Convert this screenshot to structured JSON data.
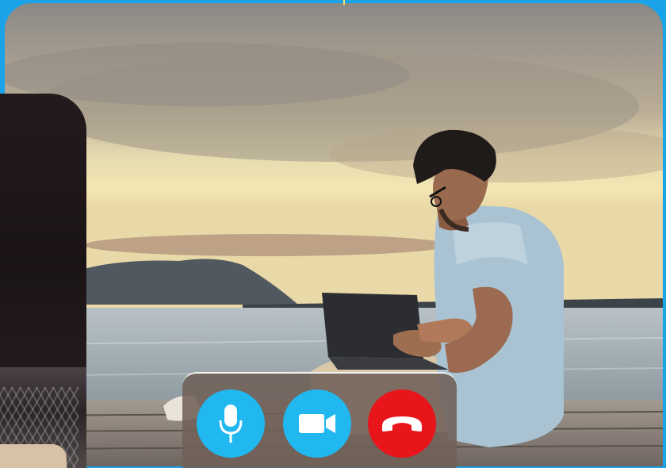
{
  "call": {
    "controls": [
      {
        "icon": "microphone-icon",
        "color": "#21b8f0"
      },
      {
        "icon": "video-camera-icon",
        "color": "#21b8f0"
      },
      {
        "icon": "phone-hangup-icon",
        "color": "#e8151b"
      }
    ]
  },
  "colors": {
    "frame": "#1aa3e8",
    "control_bar": "#706058"
  }
}
